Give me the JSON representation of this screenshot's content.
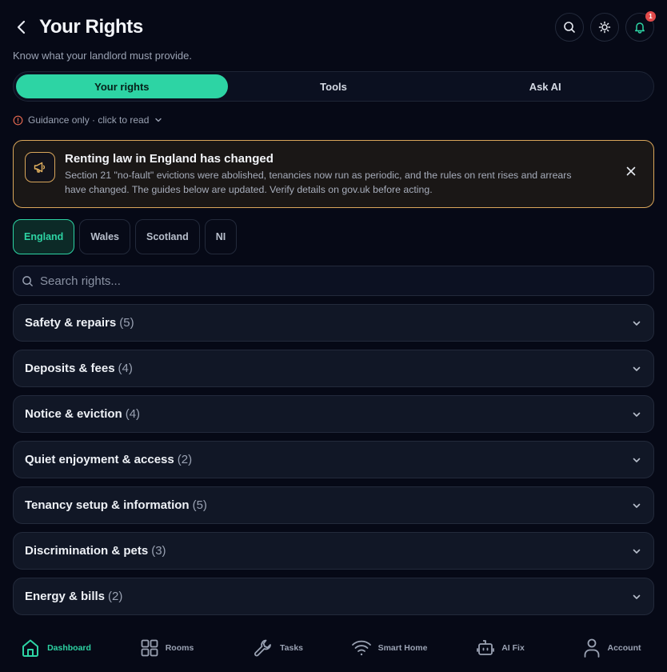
{
  "header": {
    "title": "Your Rights",
    "subtitle": "Know what your landlord must provide.",
    "notification_count": "1"
  },
  "tabs": [
    {
      "label": "Your rights",
      "active": true
    },
    {
      "label": "Tools",
      "active": false
    },
    {
      "label": "Ask AI",
      "active": false
    }
  ],
  "guidance": {
    "label": "Guidance only · click to read"
  },
  "banner": {
    "title": "Renting law in England has changed",
    "text": "Section 21 \"no-fault\" evictions were abolished, tenancies now run as periodic, and the rules on rent rises and arrears have changed. The guides below are updated. Verify details on gov.uk before acting."
  },
  "regions": [
    {
      "label": "England",
      "active": true
    },
    {
      "label": "Wales",
      "active": false
    },
    {
      "label": "Scotland",
      "active": false
    },
    {
      "label": "NI",
      "active": false
    }
  ],
  "search": {
    "placeholder": "Search rights...",
    "value": ""
  },
  "categories": [
    {
      "name": "Safety & repairs",
      "count": "(5)"
    },
    {
      "name": "Deposits & fees",
      "count": "(4)"
    },
    {
      "name": "Notice & eviction",
      "count": "(4)"
    },
    {
      "name": "Quiet enjoyment & access",
      "count": "(2)"
    },
    {
      "name": "Tenancy setup & information",
      "count": "(5)"
    },
    {
      "name": "Discrimination & pets",
      "count": "(3)"
    },
    {
      "name": "Energy & bills",
      "count": "(2)"
    }
  ],
  "bottom_nav": [
    {
      "label": "Dashboard",
      "icon": "home-icon",
      "active": true
    },
    {
      "label": "Rooms",
      "icon": "grid-icon",
      "active": false
    },
    {
      "label": "Tasks",
      "icon": "wrench-icon",
      "active": false
    },
    {
      "label": "Smart Home",
      "icon": "wifi-icon",
      "active": false
    },
    {
      "label": "AI Fix",
      "icon": "robot-icon",
      "active": false
    },
    {
      "label": "Account",
      "icon": "user-icon",
      "active": false
    }
  ],
  "colors": {
    "accent": "#2dd4a4",
    "background": "#060916",
    "banner_border": "#d9a65a",
    "badge": "#e24b4b"
  }
}
